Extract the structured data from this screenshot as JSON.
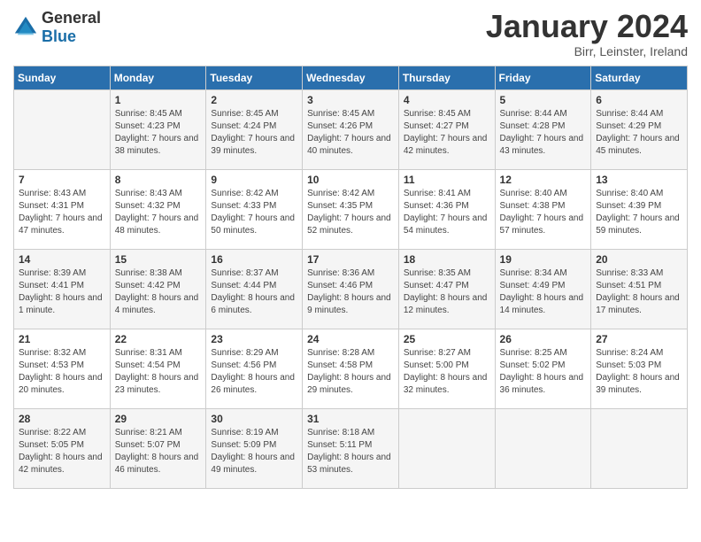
{
  "logo": {
    "general": "General",
    "blue": "Blue"
  },
  "title": "January 2024",
  "location": "Birr, Leinster, Ireland",
  "headers": [
    "Sunday",
    "Monday",
    "Tuesday",
    "Wednesday",
    "Thursday",
    "Friday",
    "Saturday"
  ],
  "weeks": [
    [
      {
        "day": "",
        "sunrise": "",
        "sunset": "",
        "daylight": ""
      },
      {
        "day": "1",
        "sunrise": "Sunrise: 8:45 AM",
        "sunset": "Sunset: 4:23 PM",
        "daylight": "Daylight: 7 hours and 38 minutes."
      },
      {
        "day": "2",
        "sunrise": "Sunrise: 8:45 AM",
        "sunset": "Sunset: 4:24 PM",
        "daylight": "Daylight: 7 hours and 39 minutes."
      },
      {
        "day": "3",
        "sunrise": "Sunrise: 8:45 AM",
        "sunset": "Sunset: 4:26 PM",
        "daylight": "Daylight: 7 hours and 40 minutes."
      },
      {
        "day": "4",
        "sunrise": "Sunrise: 8:45 AM",
        "sunset": "Sunset: 4:27 PM",
        "daylight": "Daylight: 7 hours and 42 minutes."
      },
      {
        "day": "5",
        "sunrise": "Sunrise: 8:44 AM",
        "sunset": "Sunset: 4:28 PM",
        "daylight": "Daylight: 7 hours and 43 minutes."
      },
      {
        "day": "6",
        "sunrise": "Sunrise: 8:44 AM",
        "sunset": "Sunset: 4:29 PM",
        "daylight": "Daylight: 7 hours and 45 minutes."
      }
    ],
    [
      {
        "day": "7",
        "sunrise": "Sunrise: 8:43 AM",
        "sunset": "Sunset: 4:31 PM",
        "daylight": "Daylight: 7 hours and 47 minutes."
      },
      {
        "day": "8",
        "sunrise": "Sunrise: 8:43 AM",
        "sunset": "Sunset: 4:32 PM",
        "daylight": "Daylight: 7 hours and 48 minutes."
      },
      {
        "day": "9",
        "sunrise": "Sunrise: 8:42 AM",
        "sunset": "Sunset: 4:33 PM",
        "daylight": "Daylight: 7 hours and 50 minutes."
      },
      {
        "day": "10",
        "sunrise": "Sunrise: 8:42 AM",
        "sunset": "Sunset: 4:35 PM",
        "daylight": "Daylight: 7 hours and 52 minutes."
      },
      {
        "day": "11",
        "sunrise": "Sunrise: 8:41 AM",
        "sunset": "Sunset: 4:36 PM",
        "daylight": "Daylight: 7 hours and 54 minutes."
      },
      {
        "day": "12",
        "sunrise": "Sunrise: 8:40 AM",
        "sunset": "Sunset: 4:38 PM",
        "daylight": "Daylight: 7 hours and 57 minutes."
      },
      {
        "day": "13",
        "sunrise": "Sunrise: 8:40 AM",
        "sunset": "Sunset: 4:39 PM",
        "daylight": "Daylight: 7 hours and 59 minutes."
      }
    ],
    [
      {
        "day": "14",
        "sunrise": "Sunrise: 8:39 AM",
        "sunset": "Sunset: 4:41 PM",
        "daylight": "Daylight: 8 hours and 1 minute."
      },
      {
        "day": "15",
        "sunrise": "Sunrise: 8:38 AM",
        "sunset": "Sunset: 4:42 PM",
        "daylight": "Daylight: 8 hours and 4 minutes."
      },
      {
        "day": "16",
        "sunrise": "Sunrise: 8:37 AM",
        "sunset": "Sunset: 4:44 PM",
        "daylight": "Daylight: 8 hours and 6 minutes."
      },
      {
        "day": "17",
        "sunrise": "Sunrise: 8:36 AM",
        "sunset": "Sunset: 4:46 PM",
        "daylight": "Daylight: 8 hours and 9 minutes."
      },
      {
        "day": "18",
        "sunrise": "Sunrise: 8:35 AM",
        "sunset": "Sunset: 4:47 PM",
        "daylight": "Daylight: 8 hours and 12 minutes."
      },
      {
        "day": "19",
        "sunrise": "Sunrise: 8:34 AM",
        "sunset": "Sunset: 4:49 PM",
        "daylight": "Daylight: 8 hours and 14 minutes."
      },
      {
        "day": "20",
        "sunrise": "Sunrise: 8:33 AM",
        "sunset": "Sunset: 4:51 PM",
        "daylight": "Daylight: 8 hours and 17 minutes."
      }
    ],
    [
      {
        "day": "21",
        "sunrise": "Sunrise: 8:32 AM",
        "sunset": "Sunset: 4:53 PM",
        "daylight": "Daylight: 8 hours and 20 minutes."
      },
      {
        "day": "22",
        "sunrise": "Sunrise: 8:31 AM",
        "sunset": "Sunset: 4:54 PM",
        "daylight": "Daylight: 8 hours and 23 minutes."
      },
      {
        "day": "23",
        "sunrise": "Sunrise: 8:29 AM",
        "sunset": "Sunset: 4:56 PM",
        "daylight": "Daylight: 8 hours and 26 minutes."
      },
      {
        "day": "24",
        "sunrise": "Sunrise: 8:28 AM",
        "sunset": "Sunset: 4:58 PM",
        "daylight": "Daylight: 8 hours and 29 minutes."
      },
      {
        "day": "25",
        "sunrise": "Sunrise: 8:27 AM",
        "sunset": "Sunset: 5:00 PM",
        "daylight": "Daylight: 8 hours and 32 minutes."
      },
      {
        "day": "26",
        "sunrise": "Sunrise: 8:25 AM",
        "sunset": "Sunset: 5:02 PM",
        "daylight": "Daylight: 8 hours and 36 minutes."
      },
      {
        "day": "27",
        "sunrise": "Sunrise: 8:24 AM",
        "sunset": "Sunset: 5:03 PM",
        "daylight": "Daylight: 8 hours and 39 minutes."
      }
    ],
    [
      {
        "day": "28",
        "sunrise": "Sunrise: 8:22 AM",
        "sunset": "Sunset: 5:05 PM",
        "daylight": "Daylight: 8 hours and 42 minutes."
      },
      {
        "day": "29",
        "sunrise": "Sunrise: 8:21 AM",
        "sunset": "Sunset: 5:07 PM",
        "daylight": "Daylight: 8 hours and 46 minutes."
      },
      {
        "day": "30",
        "sunrise": "Sunrise: 8:19 AM",
        "sunset": "Sunset: 5:09 PM",
        "daylight": "Daylight: 8 hours and 49 minutes."
      },
      {
        "day": "31",
        "sunrise": "Sunrise: 8:18 AM",
        "sunset": "Sunset: 5:11 PM",
        "daylight": "Daylight: 8 hours and 53 minutes."
      },
      {
        "day": "",
        "sunrise": "",
        "sunset": "",
        "daylight": ""
      },
      {
        "day": "",
        "sunrise": "",
        "sunset": "",
        "daylight": ""
      },
      {
        "day": "",
        "sunrise": "",
        "sunset": "",
        "daylight": ""
      }
    ]
  ]
}
